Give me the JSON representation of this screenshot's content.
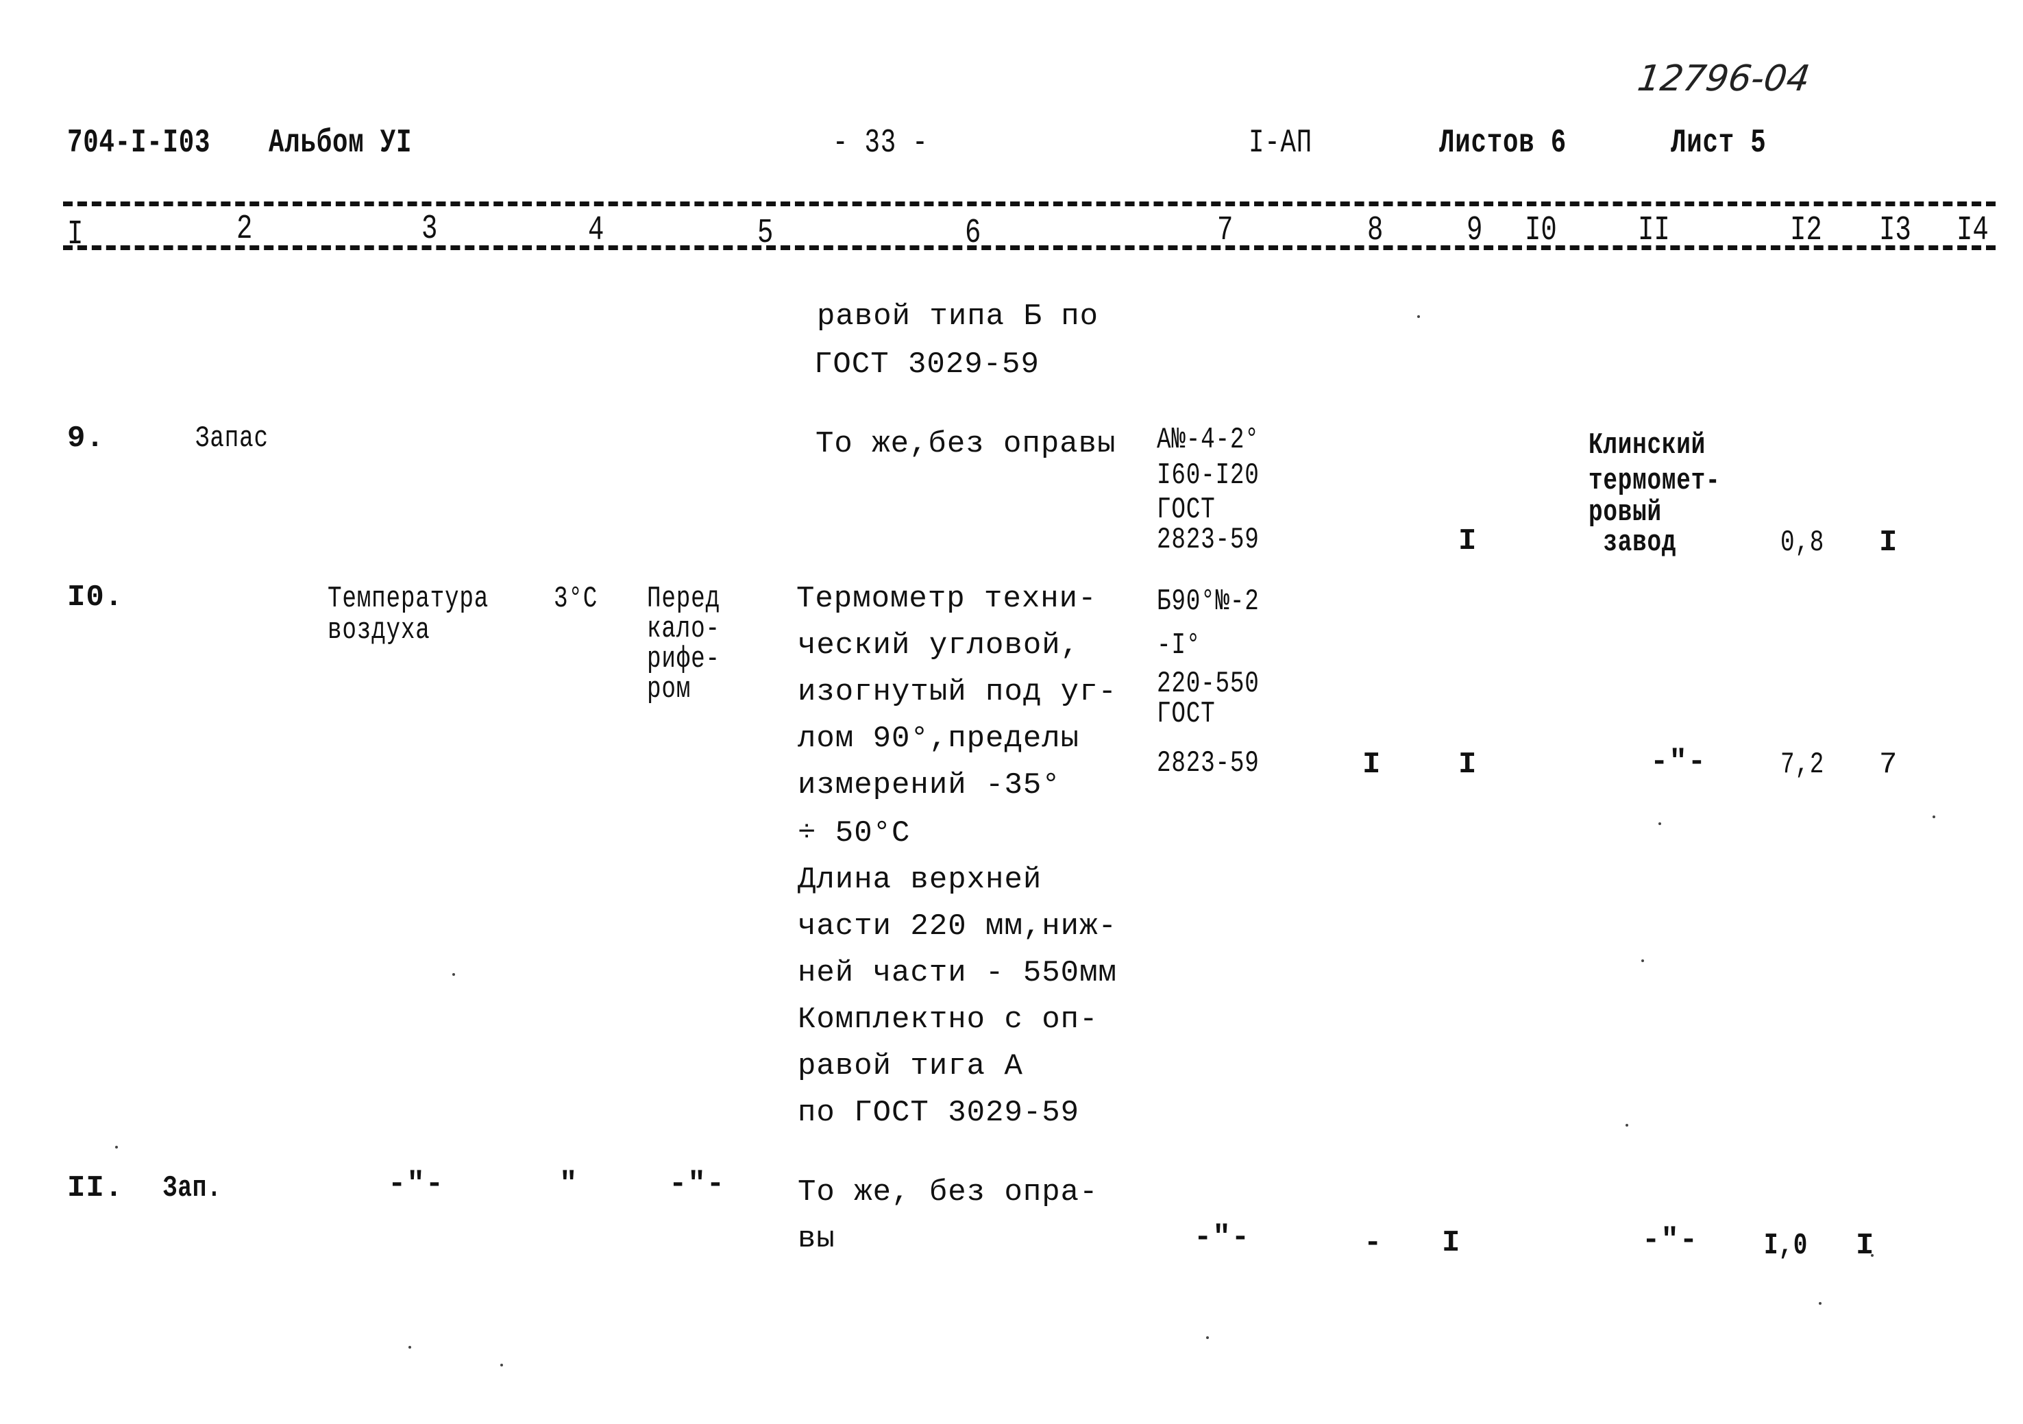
{
  "header": {
    "archive_number": "12796-04",
    "project_code": "704-I-I03",
    "album": "Альбом УI",
    "page_number": "- 33 -",
    "section": "I-АП",
    "sheets_total": "Листов 6",
    "sheet": "Лист 5"
  },
  "columns": [
    "I",
    "2",
    "3",
    "4",
    "5",
    "6",
    "7",
    "8",
    "9",
    "I0",
    "II",
    "I2",
    "I3",
    "I4"
  ],
  "continuation": {
    "description_lines": [
      "равой типа Б по",
      "ГОСТ 3029-59"
    ]
  },
  "rows": [
    {
      "number": "9.",
      "name": "Запас",
      "parameter": "",
      "value": "",
      "location": "",
      "description_lines": [
        "То же,без оправы"
      ],
      "type_lines": [
        "А№-4-2°",
        "I60-I20",
        "ГОСТ",
        "2823-59"
      ],
      "col8": "",
      "col9": "I",
      "col10": "",
      "manufacturer_lines": [
        "Клинский",
        "термомет-",
        "ровый",
        " завод"
      ],
      "col12": "0,8",
      "col13": "I"
    },
    {
      "number": "I0.",
      "name": "",
      "parameter_lines": [
        "Температура",
        "воздуха"
      ],
      "value": "3°С",
      "location_lines": [
        "Перед",
        "кало-",
        "рифе-",
        "ром"
      ],
      "description_lines": [
        "Термометр техни-",
        "ческий угловой,",
        "изогнутый под уг-",
        "лом 90°,пределы",
        "измерений -35°",
        "÷ 50°С",
        "Длина верхней",
        "части 220 мм,ниж-",
        "ней части - 550мм",
        "Комплектно с оп-",
        "равой тига А",
        "по ГОСТ 3029-59"
      ],
      "type_lines": [
        "Б90°№-2",
        "-I°",
        "220-550",
        "ГОСТ",
        "2823-59"
      ],
      "col8": "I",
      "col9": "I",
      "col10": "",
      "manufacturer": "-\"-",
      "col12": "7,2",
      "col13": "7"
    },
    {
      "number": "II.",
      "name": "Зап.",
      "parameter": "-\"-",
      "value": "\"",
      "location": "-\"-",
      "description_lines": [
        "То же, без опра-",
        "вы"
      ],
      "type": "-\"-",
      "col8": "-",
      "col9": "I",
      "col10": "",
      "manufacturer": "-\"-",
      "col12": "I,0",
      "col13": "I"
    }
  ]
}
